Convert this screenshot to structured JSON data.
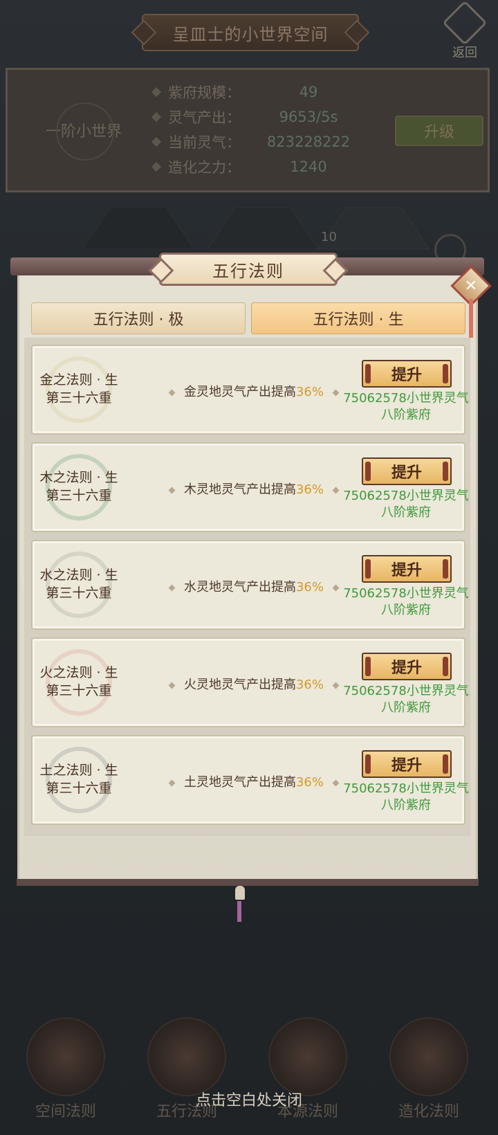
{
  "header": {
    "title": "呈皿士的小世界空间",
    "back_label": "返回"
  },
  "world_info": {
    "name": "一阶小世界",
    "stats": [
      {
        "label": "紫府规模：",
        "value": "49"
      },
      {
        "label": "灵气产出：",
        "value": "9653/5s"
      },
      {
        "label": "当前灵气：",
        "value": "823228222"
      },
      {
        "label": "造化之力：",
        "value": "1240"
      }
    ],
    "upgrade_label": "升级"
  },
  "map": {
    "hex_count_label": "10"
  },
  "modal": {
    "title": "五行法则",
    "close_icon": "close-x-icon",
    "tabs": [
      {
        "label": "五行法则 · 极",
        "active": false
      },
      {
        "label": "五行法则 · 生",
        "active": true
      }
    ],
    "rules": [
      {
        "name_line1": "金之法则 · 生",
        "name_line2": "第三十六重",
        "desc": "金灵地灵气产出提高",
        "pct": "36%",
        "button": "提升",
        "cost_line1": "75062578小世界灵气",
        "cost_line2": "八阶紫府",
        "icon_color": "#d8cf9a"
      },
      {
        "name_line1": "木之法则 · 生",
        "name_line2": "第三十六重",
        "desc": "木灵地灵气产出提高",
        "pct": "36%",
        "button": "提升",
        "cost_line1": "75062578小世界灵气",
        "cost_line2": "八阶紫府",
        "icon_color": "#7fa882"
      },
      {
        "name_line1": "水之法则 · 生",
        "name_line2": "第三十六重",
        "desc": "水灵地灵气产出提高",
        "pct": "36%",
        "button": "提升",
        "cost_line1": "75062578小世界灵气",
        "cost_line2": "八阶紫府",
        "icon_color": "#a9b0a4"
      },
      {
        "name_line1": "火之法则 · 生",
        "name_line2": "第三十六重",
        "desc": "火灵地灵气产出提高",
        "pct": "36%",
        "button": "提升",
        "cost_line1": "75062578小世界灵气",
        "cost_line2": "八阶紫府",
        "icon_color": "#e0a9a0"
      },
      {
        "name_line1": "土之法则 · 生",
        "name_line2": "第三十六重",
        "desc": "土灵地灵气产出提高",
        "pct": "36%",
        "button": "提升",
        "cost_line1": "75062578小世界灵气",
        "cost_line2": "八阶紫府",
        "icon_color": "#9a9a9a"
      }
    ]
  },
  "close_hint": "点击空白处关闭",
  "bottom_nav": [
    {
      "label": "空间法则"
    },
    {
      "label": "五行法则"
    },
    {
      "label": "本源法则"
    },
    {
      "label": "造化法则"
    }
  ]
}
